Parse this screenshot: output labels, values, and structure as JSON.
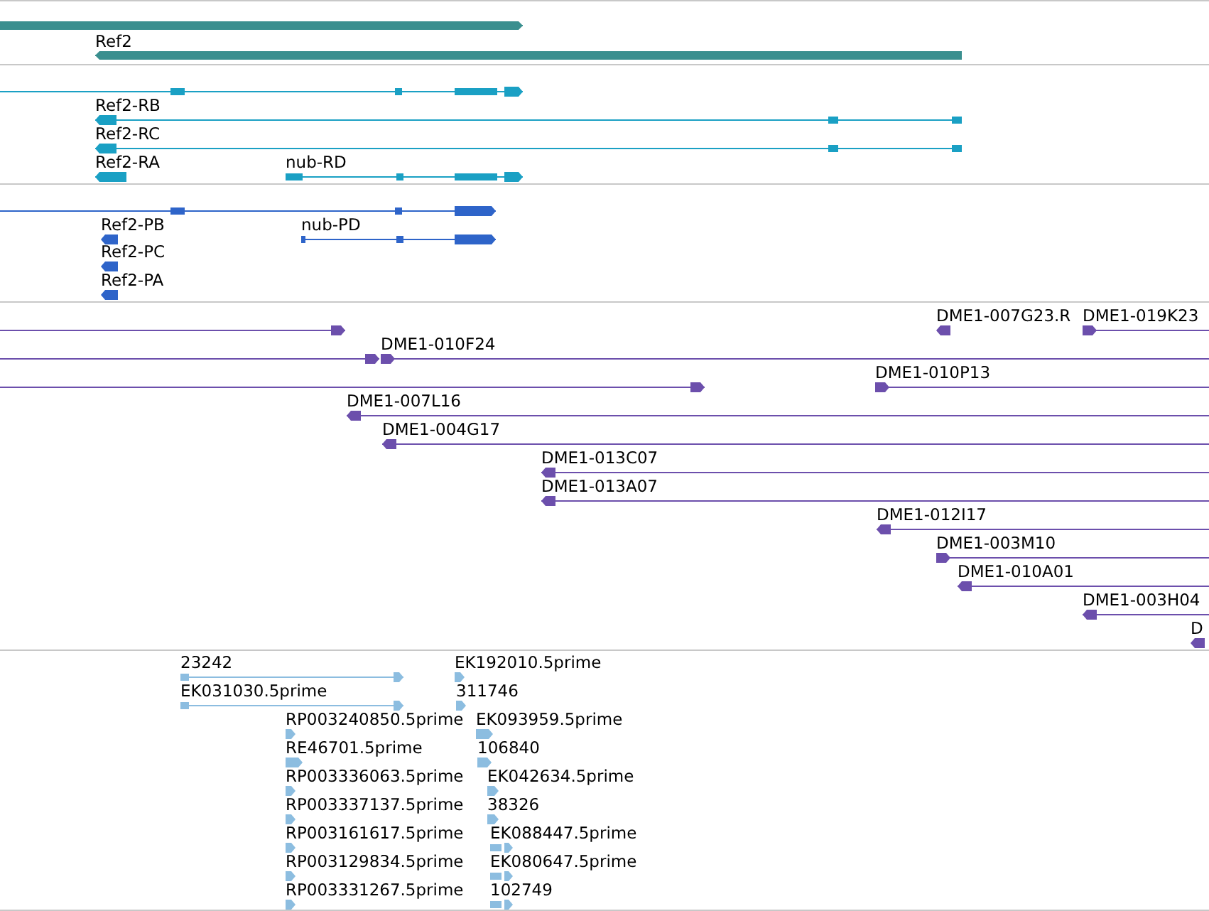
{
  "tracks": [
    {
      "kind": "gene",
      "features": [
        {
          "reverse": false
        },
        {
          "label": "Ref2",
          "reverse": true
        }
      ]
    },
    {
      "kind": "transcript",
      "features": [
        {
          "reverse": false
        },
        {
          "label": "Ref2-RB",
          "reverse": true
        },
        {
          "label": "Ref2-RC",
          "reverse": true
        },
        {
          "label": "Ref2-RA",
          "reverse": true
        },
        {
          "label": "nub-RD",
          "reverse": false
        }
      ]
    },
    {
      "kind": "protein",
      "features": [
        {
          "reverse": false
        },
        {
          "label": "Ref2-PB",
          "reverse": true
        },
        {
          "label": "nub-PD",
          "reverse": false
        },
        {
          "label": "Ref2-PC",
          "reverse": true
        },
        {
          "label": "Ref2-PA",
          "reverse": true
        }
      ]
    },
    {
      "kind": "clone",
      "features": [
        {
          "reverse": false
        },
        {
          "label": "DME1-007G23.R",
          "reverse": true
        },
        {
          "label": "DME1-019K23",
          "reverse": false
        },
        {
          "reverse": false
        },
        {
          "label": "DME1-010F24",
          "reverse": false
        },
        {
          "reverse": false
        },
        {
          "label": "DME1-010P13",
          "reverse": false
        },
        {
          "label": "DME1-007L16",
          "reverse": true
        },
        {
          "label": "DME1-004G17",
          "reverse": true
        },
        {
          "label": "DME1-013C07",
          "reverse": true
        },
        {
          "label": "DME1-013A07",
          "reverse": true
        },
        {
          "label": "DME1-012I17",
          "reverse": true
        },
        {
          "label": "DME1-003M10",
          "reverse": false
        },
        {
          "label": "DME1-010A01",
          "reverse": true
        },
        {
          "label": "DME1-003H04",
          "reverse": true
        },
        {
          "label": "D",
          "reverse": true
        }
      ]
    },
    {
      "kind": "est",
      "features": [
        {
          "label": "23242",
          "reverse": false
        },
        {
          "label": "EK031030.5prime",
          "reverse": false
        },
        {
          "label": "RP003240850.5prime",
          "reverse": false
        },
        {
          "label": "RE46701.5prime",
          "reverse": false
        },
        {
          "label": "RP003336063.5prime",
          "reverse": false
        },
        {
          "label": "RP003337137.5prime",
          "reverse": false
        },
        {
          "label": "RP003161617.5prime",
          "reverse": false
        },
        {
          "label": "RP003129834.5prime",
          "reverse": false
        },
        {
          "label": "RP003331267.5prime",
          "reverse": false
        },
        {
          "label": "EK192010.5prime",
          "reverse": false
        },
        {
          "label": "311746",
          "reverse": false
        },
        {
          "label": "EK093959.5prime",
          "reverse": false
        },
        {
          "label": "106840",
          "reverse": false
        },
        {
          "label": "EK042634.5prime",
          "reverse": false
        },
        {
          "label": "38326",
          "reverse": false
        },
        {
          "label": "EK088447.5prime",
          "reverse": false
        },
        {
          "label": "EK080647.5prime",
          "reverse": false
        },
        {
          "label": "102749",
          "reverse": false
        }
      ]
    }
  ]
}
